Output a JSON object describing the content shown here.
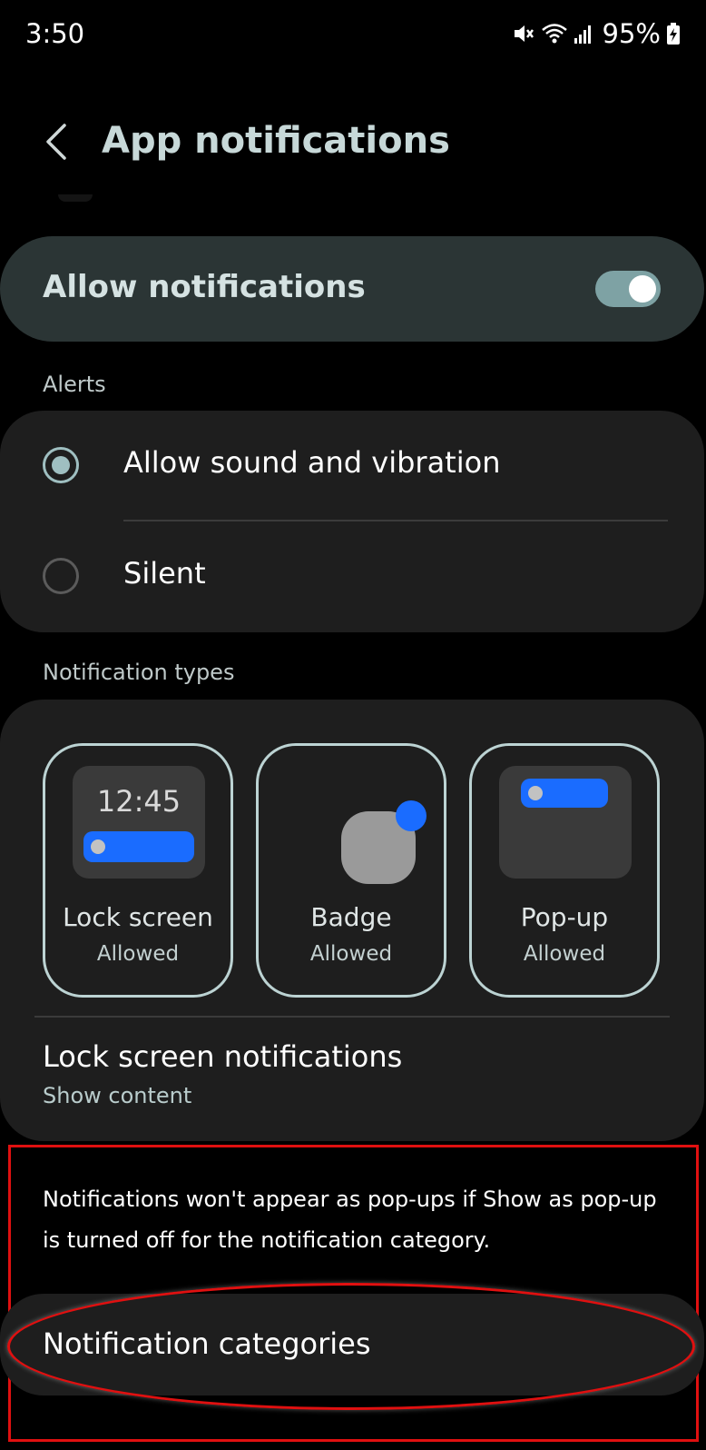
{
  "status_bar": {
    "time": "3:50",
    "battery": "95%"
  },
  "header": {
    "title": "App notifications",
    "back_icon": "chevron-left-icon"
  },
  "allow": {
    "label": "Allow notifications",
    "enabled": true
  },
  "alerts": {
    "section_label": "Alerts",
    "options": [
      {
        "label": "Allow sound and vibration",
        "selected": true
      },
      {
        "label": "Silent",
        "selected": false
      }
    ]
  },
  "notification_types": {
    "section_label": "Notification types",
    "tiles": [
      {
        "name": "Lock screen",
        "status": "Allowed",
        "preview_clock": "12:45"
      },
      {
        "name": "Badge",
        "status": "Allowed"
      },
      {
        "name": "Pop-up",
        "status": "Allowed"
      }
    ],
    "lock_screen_notifications": {
      "title": "Lock screen notifications",
      "value": "Show content"
    }
  },
  "info": {
    "text": "Notifications won't appear as pop-ups if Show as pop-up is turned off for the notification category."
  },
  "categories": {
    "label": "Notification categories"
  },
  "colors": {
    "background": "#000000",
    "card": "#1e1e1e",
    "allow_card": "#2b3535",
    "accent": "#9fbfc1",
    "blue": "#1a6cff",
    "annotation_red": "#e01010"
  }
}
